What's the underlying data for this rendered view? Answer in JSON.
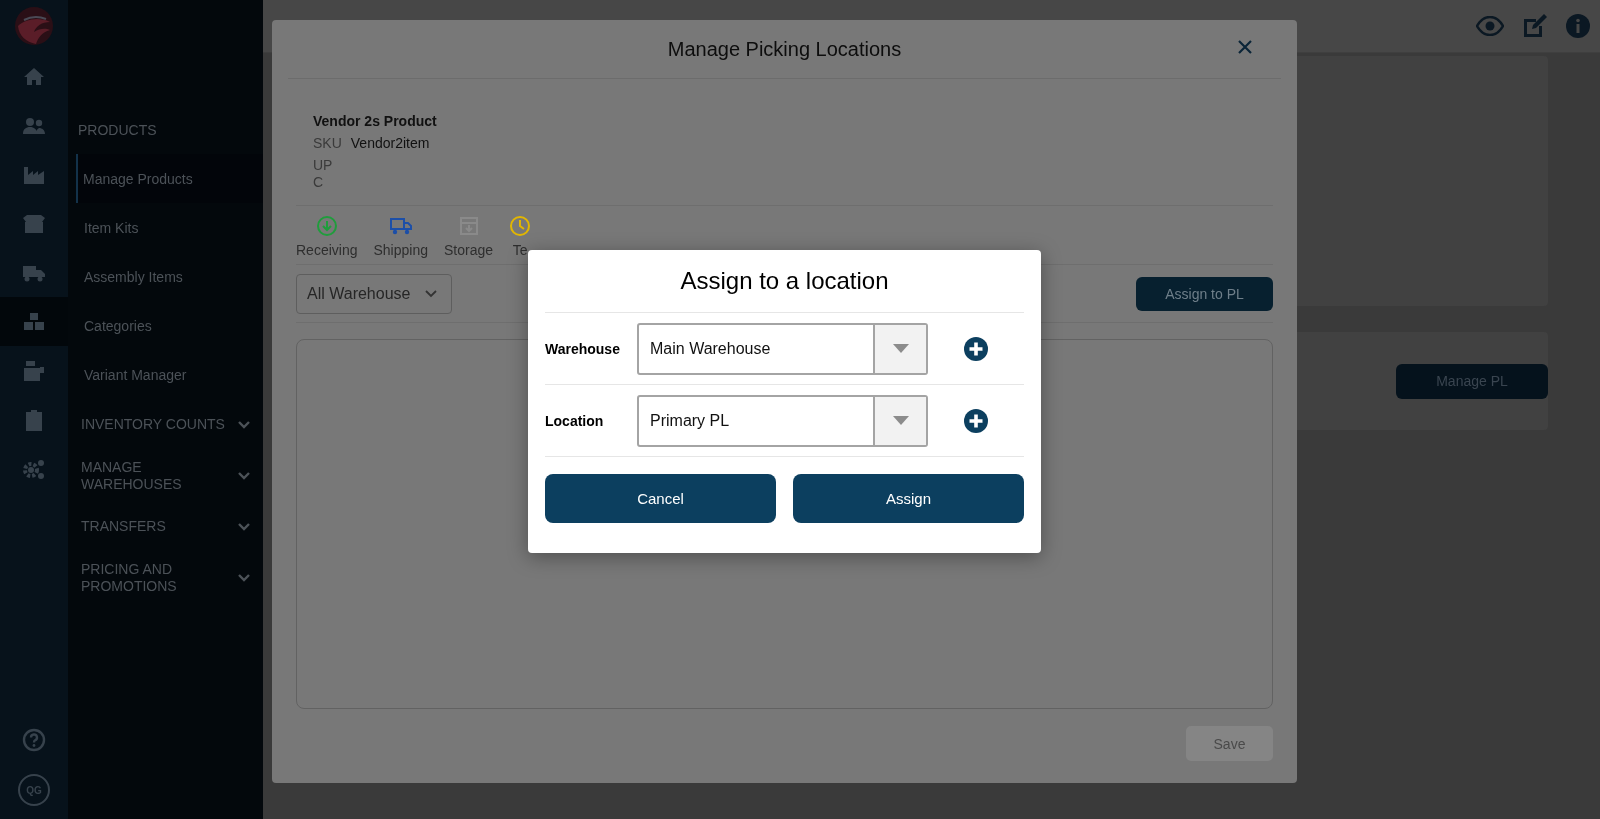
{
  "rail": {
    "items": [
      {
        "selected": false
      },
      {
        "selected": false
      },
      {
        "selected": false
      },
      {
        "selected": false
      },
      {
        "selected": false
      },
      {
        "selected": true
      },
      {
        "selected": false
      },
      {
        "selected": false
      },
      {
        "selected": false
      }
    ],
    "avatar": "QG"
  },
  "nav": {
    "heading": "PRODUCTS",
    "items": [
      {
        "label": "Manage Products",
        "selected": true
      },
      {
        "label": "Item Kits",
        "selected": false
      },
      {
        "label": "Assembly Items",
        "selected": false
      },
      {
        "label": "Categories",
        "selected": false
      },
      {
        "label": "Variant Manager",
        "selected": false
      }
    ],
    "sections": [
      {
        "label": "INVENTORY COUNTS",
        "expanded": false
      },
      {
        "label": "MANAGE WAREHOUSES",
        "expanded": false
      },
      {
        "label": "TRANSFERS",
        "expanded": false
      },
      {
        "label": "PRICING AND PROMOTIONS",
        "expanded": false
      }
    ]
  },
  "side_card": {
    "button": "Manage PL"
  },
  "picking_modal": {
    "title": "Manage Picking Locations",
    "product": {
      "name": "Vendor 2s Product",
      "sku_label": "SKU",
      "sku": "Vendor2item",
      "upc_label": "UPC"
    },
    "tabs": [
      {
        "label": "Receiving",
        "color": "#1f9d3c"
      },
      {
        "label": "Shipping",
        "color": "#1c4fa8"
      },
      {
        "label": "Storage",
        "color": "#8a8a8a"
      },
      {
        "label": "Te",
        "color": "#e2b600"
      }
    ],
    "warehouse_filter": "All Warehouse",
    "assign_button": "Assign to PL",
    "save_button": {
      "label": "Save",
      "disabled": true
    }
  },
  "assign_dialog": {
    "title": "Assign to a location",
    "fields": [
      {
        "label": "Warehouse",
        "value": "Main Warehouse"
      },
      {
        "label": "Location",
        "value": "Primary PL"
      }
    ],
    "buttons": [
      "Cancel",
      "Assign"
    ]
  }
}
